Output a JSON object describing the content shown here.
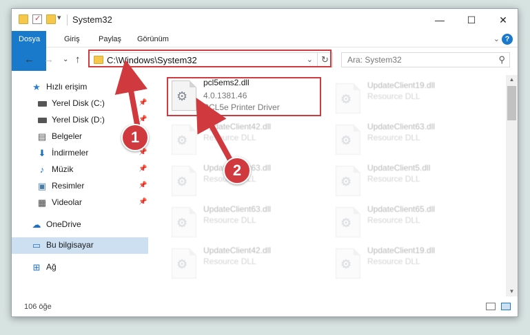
{
  "window": {
    "title": "System32"
  },
  "ribbon": {
    "tabs": [
      "Dosya",
      "Giriş",
      "Paylaş",
      "Görünüm"
    ]
  },
  "address": {
    "path": "C:\\Windows\\System32",
    "search_placeholder": "Ara: System32"
  },
  "sidebar": {
    "items": [
      {
        "label": "Hızlı erişim",
        "icon": "star-icon",
        "pinned": false
      },
      {
        "label": "Yerel Disk (C:)",
        "icon": "drive-icon",
        "pinned": true
      },
      {
        "label": "Yerel Disk (D:)",
        "icon": "drive-icon",
        "pinned": true
      },
      {
        "label": "Belgeler",
        "icon": "document-icon",
        "pinned": true
      },
      {
        "label": "İndirmeler",
        "icon": "download-icon",
        "pinned": true
      },
      {
        "label": "Müzik",
        "icon": "music-icon",
        "pinned": true
      },
      {
        "label": "Resimler",
        "icon": "pictures-icon",
        "pinned": true
      },
      {
        "label": "Videolar",
        "icon": "video-icon",
        "pinned": true
      },
      {
        "label": "OneDrive",
        "icon": "cloud-icon",
        "pinned": false
      },
      {
        "label": "Bu bilgisayar",
        "icon": "computer-icon",
        "pinned": false
      },
      {
        "label": "Ağ",
        "icon": "network-icon",
        "pinned": false
      }
    ]
  },
  "files": {
    "main": {
      "name": "pcl5ems2.dll",
      "version": "4.0.1381.46",
      "description": "PCL5e Printer Driver"
    },
    "left_column": [
      {
        "name": "UpdateClient42.dll",
        "description": "Resource DLL"
      },
      {
        "name": "UpdateClient63.dll",
        "description": "Resource DLL"
      },
      {
        "name": "UpdateClient63.dll",
        "description": "Resource DLL"
      },
      {
        "name": "UpdateClient42.dll",
        "description": "Resource DLL"
      }
    ],
    "right_column": [
      {
        "name": "UpdateClient19.dll",
        "description": "Resource DLL"
      },
      {
        "name": "UpdateClient63.dll",
        "description": "Resource DLL"
      },
      {
        "name": "UpdateClient5.dll",
        "description": "Resource DLL"
      },
      {
        "name": "UpdateClient65.dll",
        "description": "Resource DLL"
      },
      {
        "name": "UpdateClient19.dll",
        "description": "Resource DLL"
      }
    ]
  },
  "status": {
    "count": "106 öğe"
  },
  "annotations": {
    "badge1": "1",
    "badge2": "2",
    "color": "#d03a3e"
  }
}
